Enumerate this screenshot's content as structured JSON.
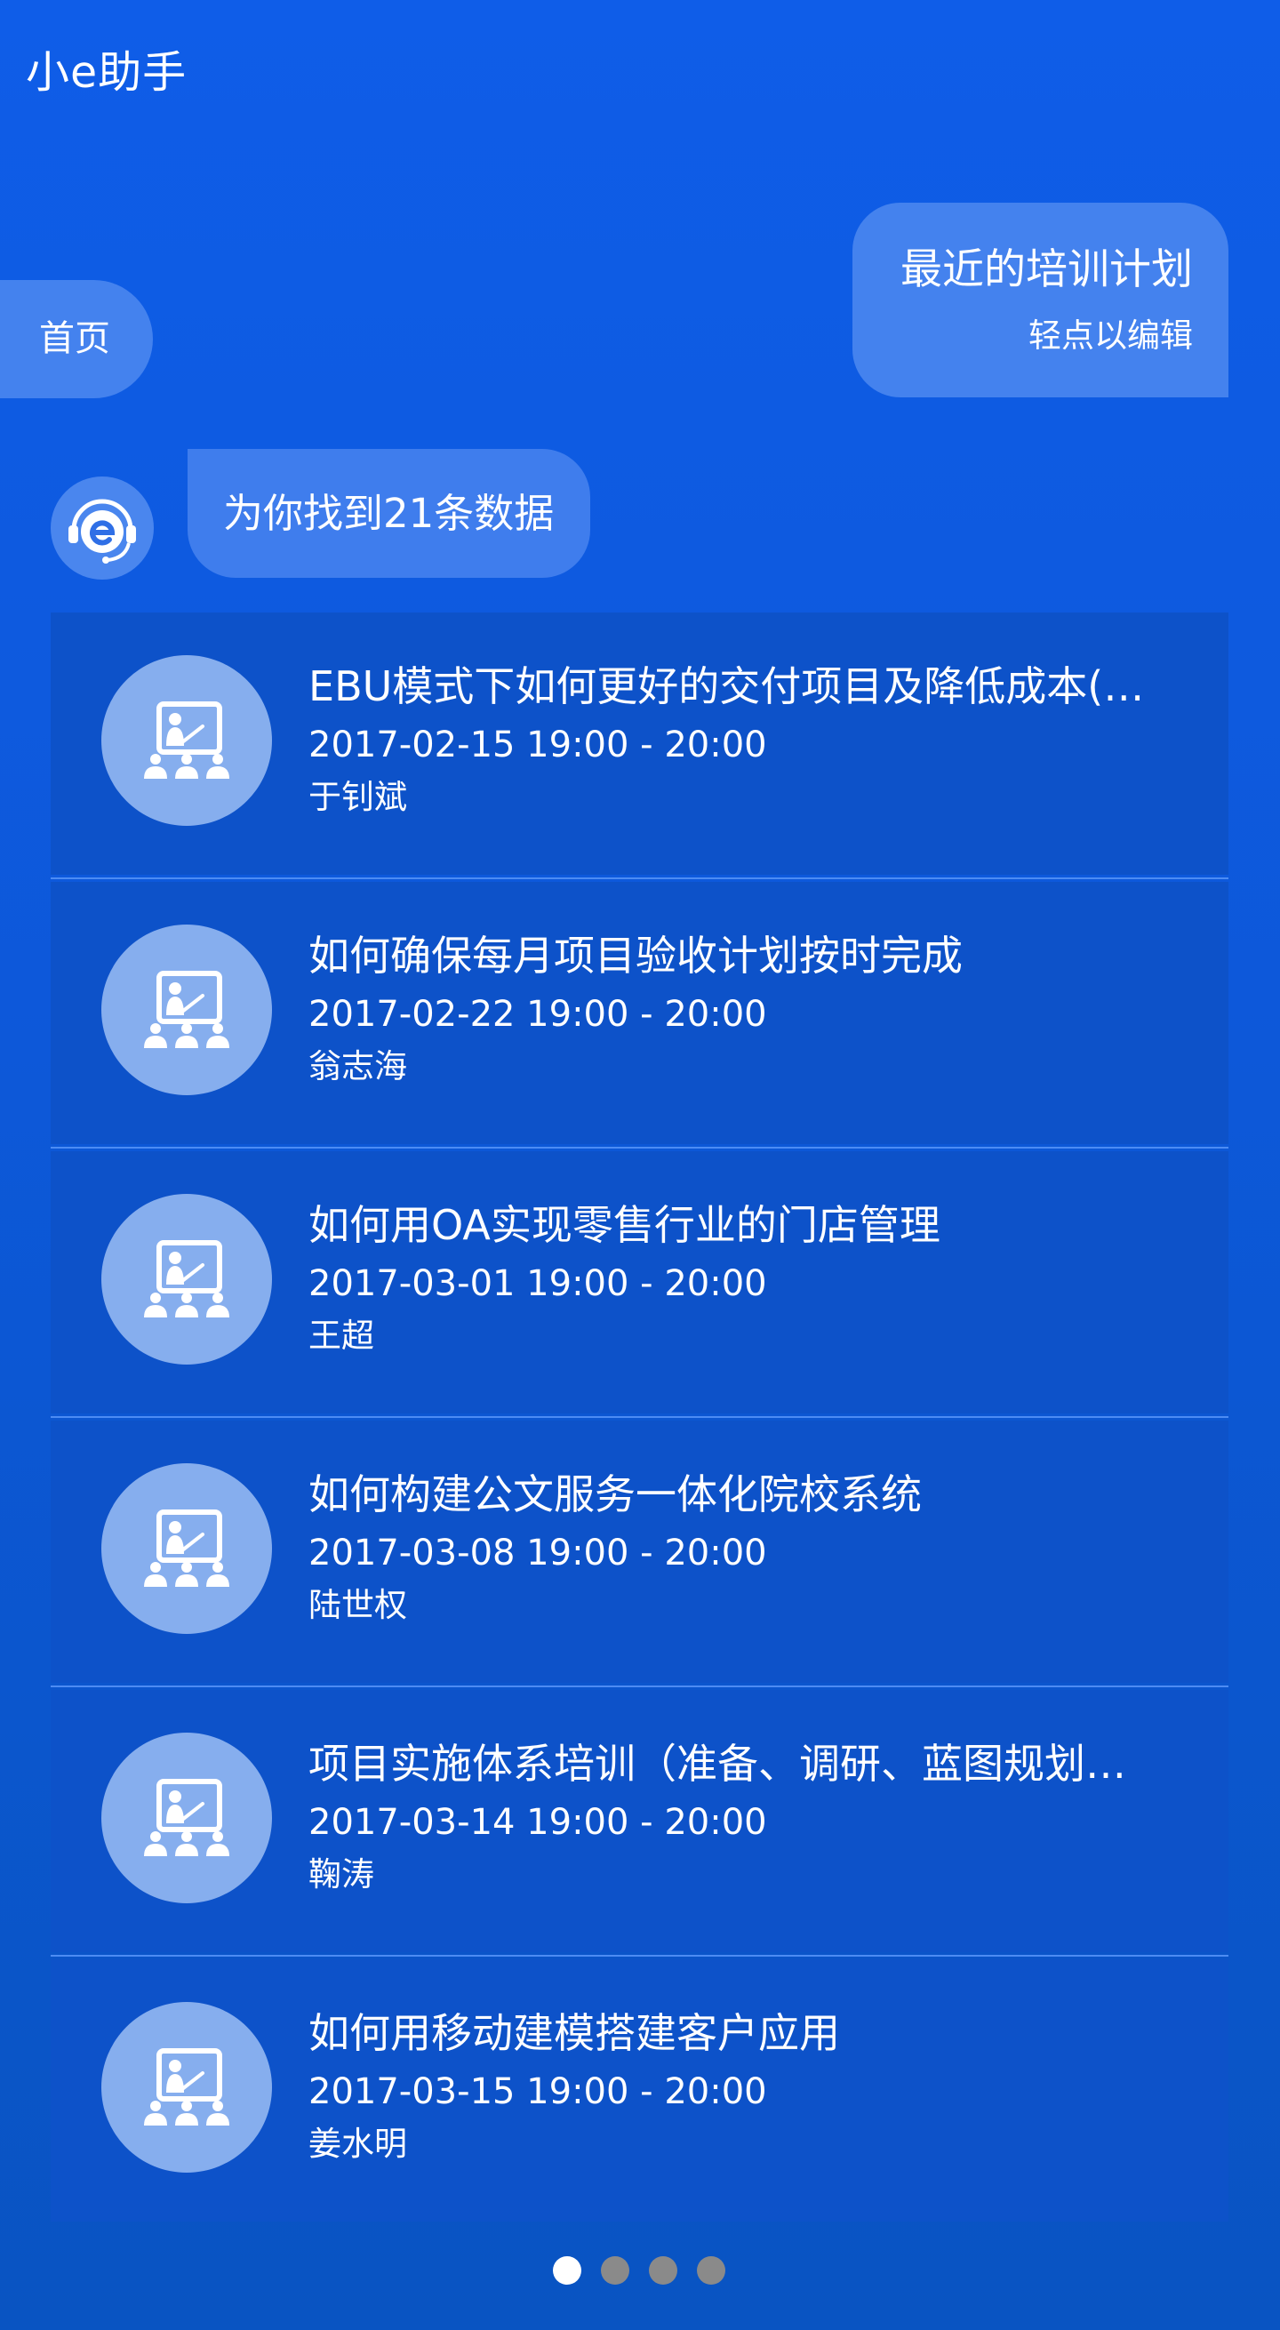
{
  "header": {
    "title": "小e助手"
  },
  "query": {
    "text": "最近的培训计划",
    "hint": "轻点以编辑"
  },
  "home_button": {
    "label": "首页"
  },
  "bot": {
    "avatar_icon": "headset-e-logo-icon",
    "message": "为你找到21条数据"
  },
  "results": [
    {
      "title": "EBU模式下如何更好的交付项目及降低成本(…",
      "time": "2017-02-15 19:00 - 20:00",
      "speaker": "于钊斌",
      "icon": "training-classroom-icon"
    },
    {
      "title": "如何确保每月项目验收计划按时完成",
      "time": "2017-02-22 19:00 - 20:00",
      "speaker": "翁志海",
      "icon": "training-classroom-icon"
    },
    {
      "title": "如何用OA实现零售行业的门店管理",
      "time": "2017-03-01 19:00 - 20:00",
      "speaker": "王超",
      "icon": "training-classroom-icon"
    },
    {
      "title": "如何构建公文服务一体化院校系统",
      "time": "2017-03-08 19:00 - 20:00",
      "speaker": "陆世权",
      "icon": "training-classroom-icon"
    },
    {
      "title": "项目实施体系培训（准备、调研、蓝图规划…",
      "time": "2017-03-14 19:00 - 20:00",
      "speaker": "鞠涛",
      "icon": "training-classroom-icon"
    },
    {
      "title": "如何用移动建模搭建客户应用",
      "time": "2017-03-15 19:00 - 20:00",
      "speaker": "姜水明",
      "icon": "training-classroom-icon"
    }
  ],
  "pager": {
    "total": 4,
    "current": 1
  },
  "colors": {
    "background": "#0f5de8",
    "bubble": "#4482ee",
    "card": "#0d52c9",
    "thumb": "#86aeee",
    "separator": "#4d8cf3",
    "dot_active": "#ffffff",
    "dot_inactive": "#8a8a8a"
  }
}
